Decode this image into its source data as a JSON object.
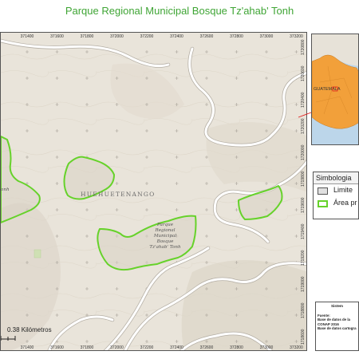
{
  "title": "Parque Regional Municipal Bosque Tz'ahab' Tonh",
  "map": {
    "region_label": "HUEHUETENANGO",
    "park_label_lines": [
      "Parque",
      "Regional",
      "Municipal",
      "Bosque",
      "Tz'ahab' Tonh"
    ],
    "small_area_label": "onh",
    "easting_ticks": [
      "371400",
      "371600",
      "371800",
      "372000",
      "372200",
      "372400",
      "372600",
      "372800",
      "373000",
      "373200"
    ],
    "northing_ticks": [
      "1720800",
      "1720600",
      "1720400",
      "1720200",
      "1720000",
      "1719800",
      "1719600",
      "1719400",
      "1719200",
      "1719000",
      "1718800",
      "1718600"
    ],
    "scale_text": "0.38 Kilómetros",
    "colors": {
      "terrain": "#e9e4da",
      "protected_area": "#66d22a",
      "road": "#ffffff",
      "road_casing": "#b4aea4"
    }
  },
  "inset": {
    "label": "GUATEMALA",
    "colors": {
      "water": "#bcd6ea",
      "country": "#f2a03a",
      "neighbour": "#e7e2d8",
      "pointer": "#e02020"
    }
  },
  "legend": {
    "heading": "Simbologia",
    "items": [
      {
        "label": "Limite",
        "swatch_fill": "#e0e0e0",
        "swatch_border": "#555555"
      },
      {
        "label": "Área pr",
        "swatch_fill": "#ffffff",
        "swatch_border": "#66d22a"
      }
    ]
  },
  "sources": {
    "heading": "Sistem",
    "label": "Fuente:",
    "lines": [
      "Base de datos de la",
      "CONAP 2016",
      "Base de datos cartogra"
    ]
  }
}
